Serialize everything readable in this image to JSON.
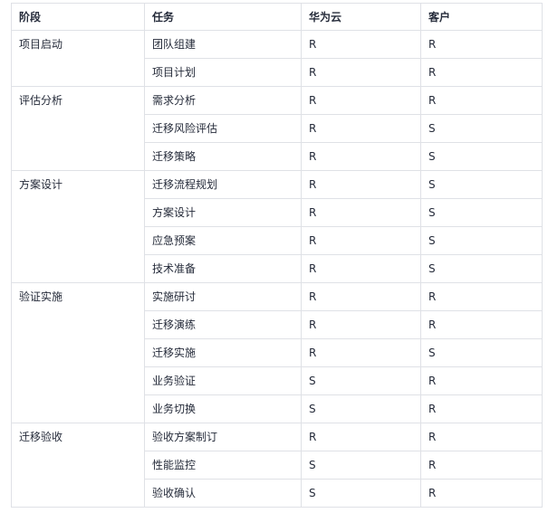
{
  "table": {
    "headers": [
      "阶段",
      "任务",
      "华为云",
      "客户"
    ],
    "groups": [
      {
        "stage": "项目启动",
        "rows": [
          {
            "task": "团队组建",
            "huawei": "R",
            "customer": "R"
          },
          {
            "task": "项目计划",
            "huawei": "R",
            "customer": "R"
          }
        ]
      },
      {
        "stage": "评估分析",
        "rows": [
          {
            "task": "需求分析",
            "huawei": "R",
            "customer": "R"
          },
          {
            "task": "迁移风险评估",
            "huawei": "R",
            "customer": "S"
          },
          {
            "task": "迁移策略",
            "huawei": "R",
            "customer": "S"
          }
        ]
      },
      {
        "stage": "方案设计",
        "rows": [
          {
            "task": "迁移流程规划",
            "huawei": "R",
            "customer": "S"
          },
          {
            "task": "方案设计",
            "huawei": "R",
            "customer": "S"
          },
          {
            "task": "应急预案",
            "huawei": "R",
            "customer": "S"
          },
          {
            "task": "技术准备",
            "huawei": "R",
            "customer": "S"
          }
        ]
      },
      {
        "stage": "验证实施",
        "rows": [
          {
            "task": "实施研讨",
            "huawei": "R",
            "customer": "R"
          },
          {
            "task": "迁移演练",
            "huawei": "R",
            "customer": "R"
          },
          {
            "task": "迁移实施",
            "huawei": "R",
            "customer": "S"
          },
          {
            "task": "业务验证",
            "huawei": "S",
            "customer": "R"
          },
          {
            "task": "业务切换",
            "huawei": "S",
            "customer": "R"
          }
        ]
      },
      {
        "stage": "迁移验收",
        "rows": [
          {
            "task": "验收方案制订",
            "huawei": "R",
            "customer": "R"
          },
          {
            "task": "性能监控",
            "huawei": "S",
            "customer": "R"
          },
          {
            "task": "验收确认",
            "huawei": "S",
            "customer": "R"
          }
        ]
      }
    ]
  }
}
